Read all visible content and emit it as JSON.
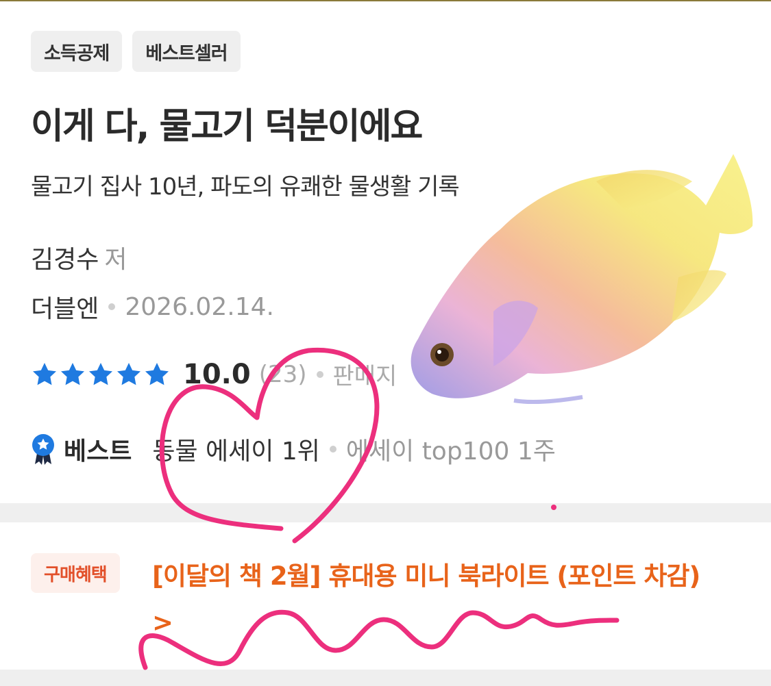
{
  "tags": [
    "소득공제",
    "베스트셀러"
  ],
  "book": {
    "title": "이게 다, 물고기 덕분이에요",
    "subtitle": "물고기 집사 10년, 파도의 유쾌한 물생활 기록",
    "author": "김경수",
    "author_role": "저",
    "publisher": "더블엔",
    "date": "2026.02.14."
  },
  "rating": {
    "stars": 5,
    "score": "10.0",
    "count": "(23)",
    "sales_label": "판매지"
  },
  "best": {
    "label": "베스트",
    "rank_primary": "동물 에세이 1위",
    "rank_secondary": "에세이 top100 1주"
  },
  "benefit": {
    "tag": "구매혜택",
    "text": "[이달의 책 2월] 휴대용 미니 북라이트 (포인트 차감) >"
  },
  "colors": {
    "star": "#1f7ae0",
    "benefit_orange": "#e8631a",
    "doodle_pink": "#ec2f7d"
  }
}
